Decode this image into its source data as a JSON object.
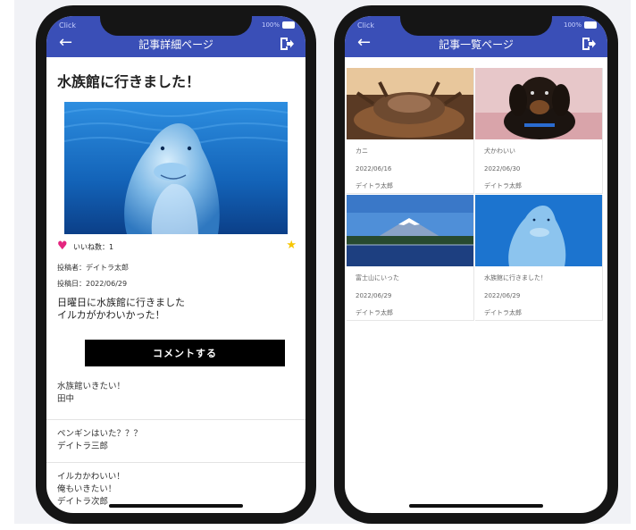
{
  "colors": {
    "app_bar": "#3a4fb7",
    "heart": "#e4257f",
    "star": "#f7c600",
    "button": "#000000"
  },
  "status_bar": {
    "carrier": "Click",
    "battery": "100%"
  },
  "detail_page": {
    "header_title": "記事詳細ページ",
    "article_title": "水族館に行きました！",
    "likes_label": "いいね数：1",
    "author_label": "投稿者：デイトラ太郎",
    "date_label": "投稿日：2022/06/29",
    "body_lines": [
      "日曜日に水族館に行きました",
      "イルカがかわいかった！"
    ],
    "comment_button": "コメントする",
    "comments": [
      {
        "lines": [
          "水族館いきたい！",
          "田中"
        ]
      },
      {
        "lines": [
          "ペンギンはいた？？？",
          "デイトラ三郎"
        ]
      },
      {
        "lines": [
          "イルカかわいい！",
          "俺もいきたい！",
          "デイトラ次郎"
        ]
      }
    ]
  },
  "list_page": {
    "header_title": "記事一覧ページ",
    "cards": [
      {
        "title": "カニ",
        "date": "2022/06/16",
        "author": "デイトラ太郎"
      },
      {
        "title": "犬かわいい",
        "date": "2022/06/30",
        "author": "デイトラ太郎"
      },
      {
        "title": "富士山にいった",
        "date": "2022/06/29",
        "author": "デイトラ太郎"
      },
      {
        "title": "水族館に行きました！",
        "date": "2022/06/29",
        "author": "デイトラ太郎"
      }
    ]
  }
}
